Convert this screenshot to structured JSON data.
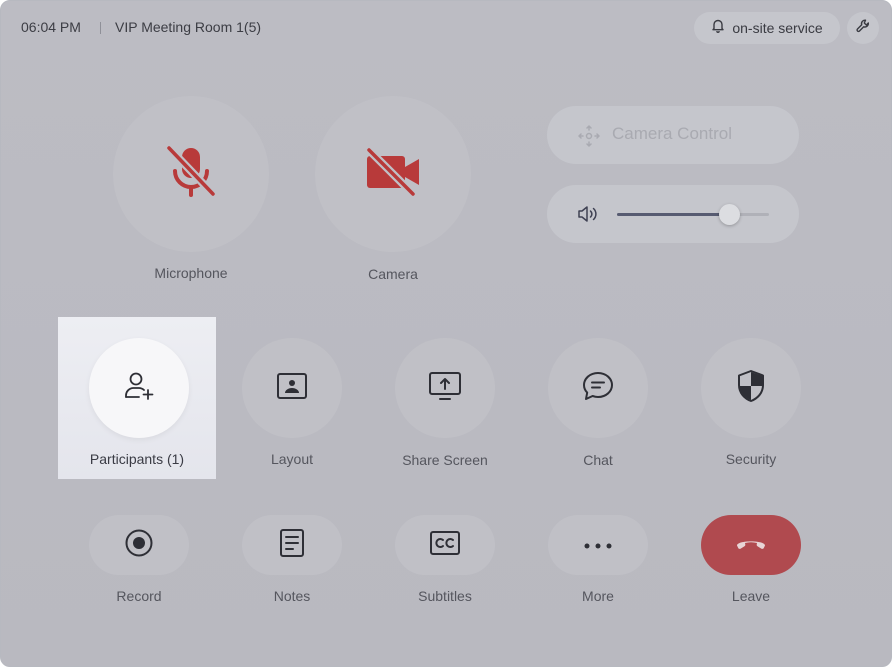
{
  "status_bar": {
    "time": "06:04 PM",
    "room_title": "VIP Meeting Room 1(5)",
    "service_label": "on-site service",
    "service_icon": "bell-icon",
    "settings_icon": "wrench-icon"
  },
  "media": {
    "microphone": {
      "label": "Microphone",
      "state": "muted",
      "icon": "microphone-muted-icon"
    },
    "camera": {
      "label": "Camera",
      "state": "off",
      "icon": "camera-off-icon"
    },
    "muted_color": "#b83a3a"
  },
  "camera_control": {
    "label": "Camera Control",
    "state": "disabled",
    "icon": "move-arrows-icon"
  },
  "volume": {
    "icon": "speaker-icon",
    "level_percent": 74
  },
  "actions_row1": [
    {
      "id": "participants",
      "label": "Participants (1)",
      "icon": "add-user-icon"
    },
    {
      "id": "layout",
      "label": "Layout",
      "icon": "layout-icon"
    },
    {
      "id": "share",
      "label": "Share Screen",
      "icon": "share-screen-icon"
    },
    {
      "id": "chat",
      "label": "Chat",
      "icon": "chat-icon"
    },
    {
      "id": "security",
      "label": "Security",
      "icon": "shield-icon"
    }
  ],
  "actions_row2": [
    {
      "id": "record",
      "label": "Record",
      "icon": "record-icon"
    },
    {
      "id": "notes",
      "label": "Notes",
      "icon": "notes-icon"
    },
    {
      "id": "subtitles",
      "label": "Subtitles",
      "icon": "cc-icon"
    },
    {
      "id": "more",
      "label": "More",
      "icon": "more-icon"
    },
    {
      "id": "leave",
      "label": "Leave",
      "icon": "hang-up-icon"
    }
  ],
  "colors": {
    "background": "#bcbcc3",
    "highlight": "#eaebf0",
    "leave": "#b04a4f",
    "slider_fill": "#575b71"
  }
}
